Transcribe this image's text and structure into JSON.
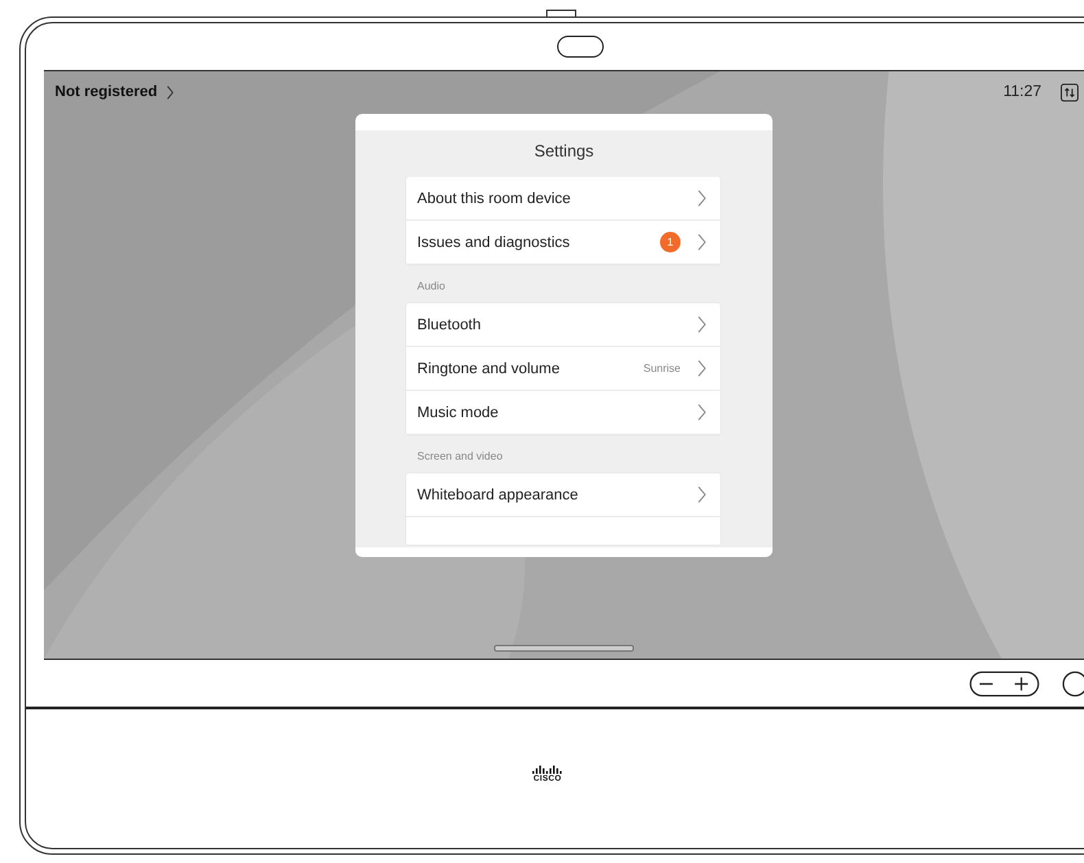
{
  "status": {
    "label": "Not registered",
    "time": "11:27"
  },
  "settings": {
    "title": "Settings",
    "sections": [
      {
        "items": [
          {
            "label": "About this room device"
          },
          {
            "label": "Issues and diagnostics",
            "badge": "1"
          }
        ]
      },
      {
        "header": "Audio",
        "items": [
          {
            "label": "Bluetooth"
          },
          {
            "label": "Ringtone and volume",
            "value": "Sunrise"
          },
          {
            "label": "Music mode"
          }
        ]
      },
      {
        "header": "Screen and video",
        "items": [
          {
            "label": "Whiteboard appearance"
          }
        ]
      }
    ]
  },
  "logo": {
    "text": "CISCO"
  }
}
